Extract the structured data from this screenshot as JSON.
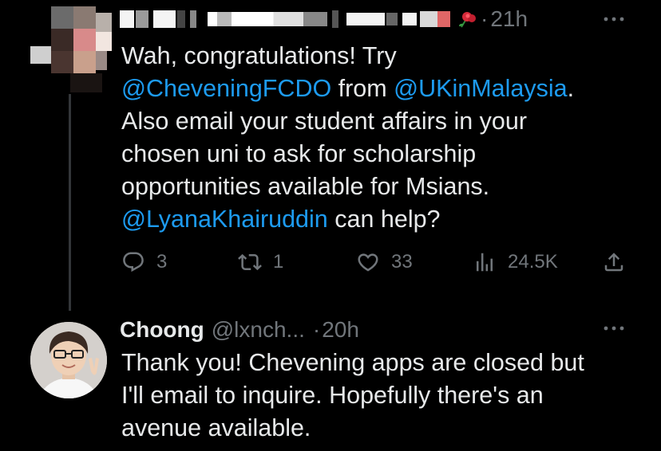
{
  "tweet1": {
    "time": "21h",
    "dot": "·",
    "text_lines": [
      [
        {
          "t": "Wah, congratulations! Try",
          "m": false
        }
      ],
      [
        {
          "t": "@CheveningFCDO",
          "m": true
        },
        {
          "t": " from ",
          "m": false
        },
        {
          "t": "@UKinMalaysia",
          "m": true
        },
        {
          "t": ".",
          "m": false
        }
      ],
      [
        {
          "t": "Also email your student affairs in your",
          "m": false
        }
      ],
      [
        {
          "t": "chosen uni to ask for scholarship",
          "m": false
        }
      ],
      [
        {
          "t": "opportunities available for Msians.",
          "m": false
        }
      ],
      [
        {
          "t": "@LyanaKhairuddin",
          "m": true
        },
        {
          "t": " can help?",
          "m": false
        }
      ]
    ],
    "actions": {
      "replies": "3",
      "reposts": "1",
      "likes": "33",
      "views": "24.5K"
    }
  },
  "tweet2": {
    "display_name": "Choong",
    "handle": "@lxnch...",
    "dot": "·",
    "time": "20h",
    "text_lines": [
      "Thank you! Chevening apps are closed but",
      "I'll email to inquire. Hopefully there's an",
      "avenue available."
    ]
  },
  "icons": {
    "reply": "reply-icon",
    "repost": "repost-icon",
    "like": "like-icon",
    "views": "views-icon",
    "share": "share-icon",
    "more": "more-icon"
  },
  "colors": {
    "background": "#000000",
    "text": "#e7e9ea",
    "secondary": "#71767b",
    "link": "#1d9bf0",
    "thread_line": "#333639"
  }
}
